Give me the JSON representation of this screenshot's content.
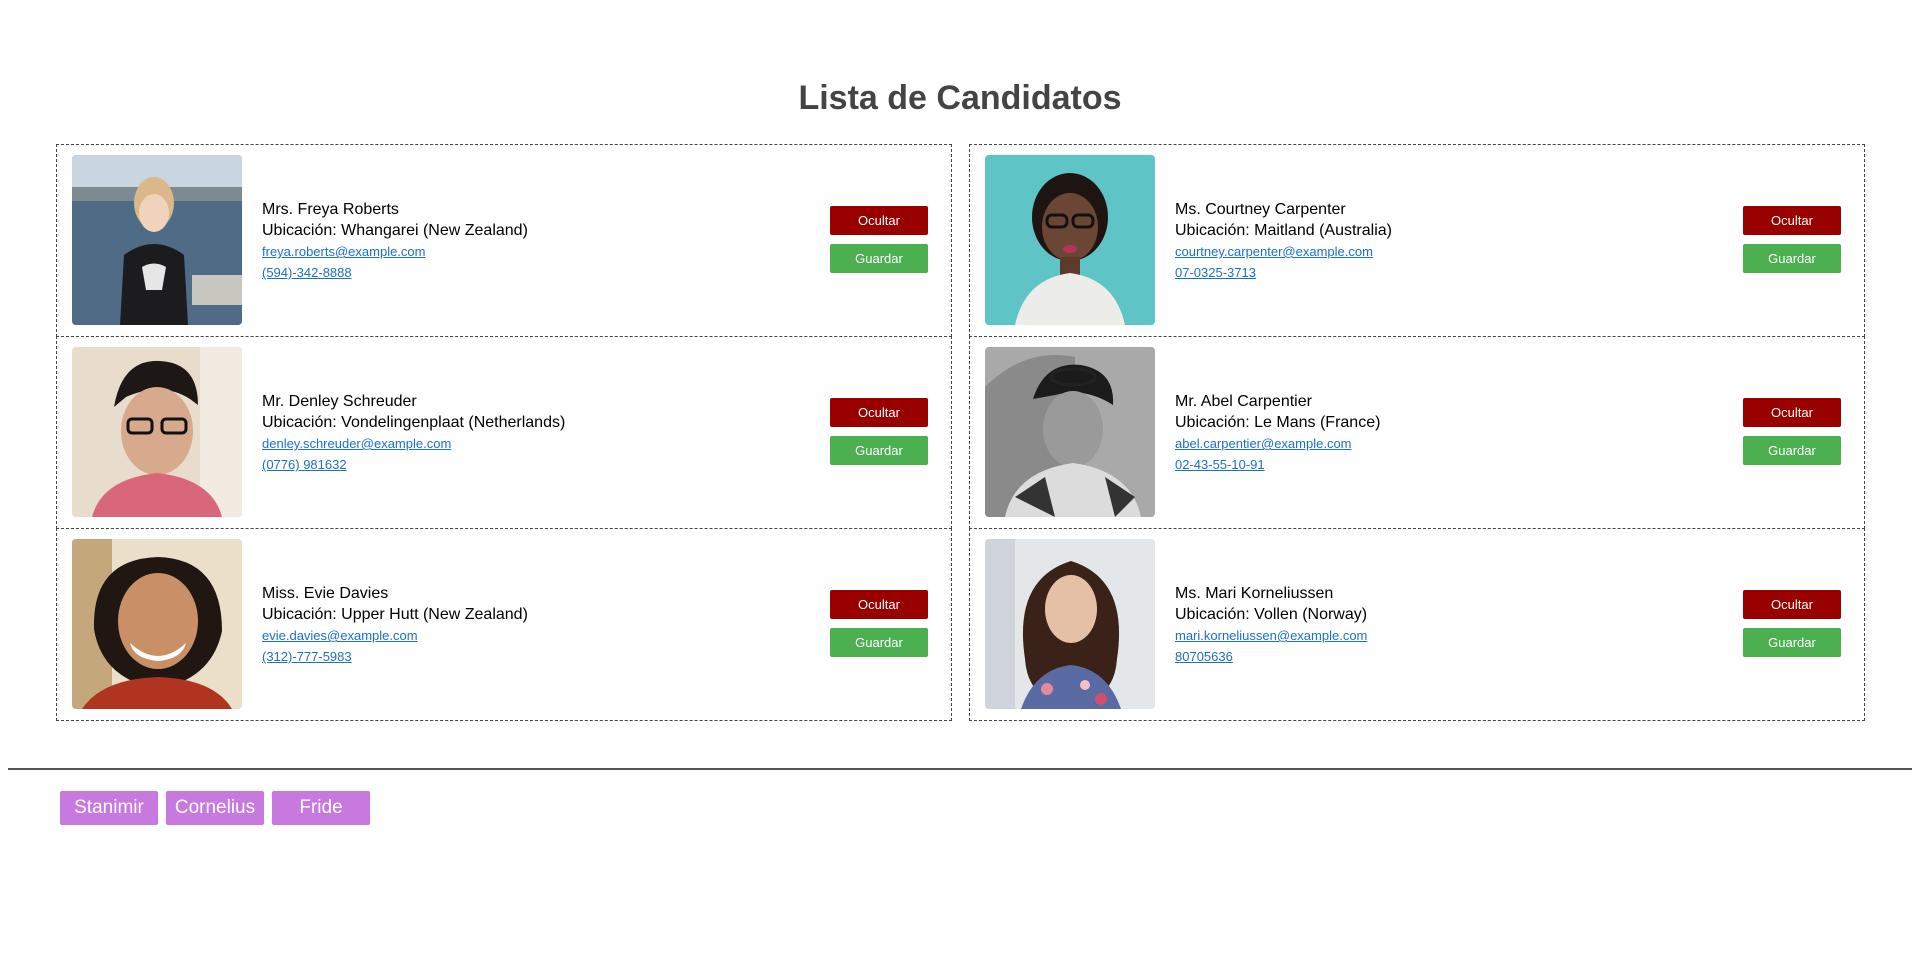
{
  "header": {
    "title": "Lista de Candidatos"
  },
  "candidates": [
    {
      "name": "Mrs. Freya Roberts",
      "location": "Ubicación: Whangarei (New Zealand)",
      "email": "freya.roberts@example.com",
      "phone": "(594)-342-8888",
      "hide_label": "Ocultar",
      "save_label": "Guardar"
    },
    {
      "name": "Ms. Courtney Carpenter",
      "location": "Ubicación: Maitland (Australia)",
      "email": "courtney.carpenter@example.com",
      "phone": "07-0325-3713",
      "hide_label": "Ocultar",
      "save_label": "Guardar"
    },
    {
      "name": "Mr. Denley Schreuder",
      "location": "Ubicación: Vondelingenplaat (Netherlands)",
      "email": "denley.schreuder@example.com",
      "phone": "(0776) 981632",
      "hide_label": "Ocultar",
      "save_label": "Guardar"
    },
    {
      "name": "Mr. Abel Carpentier",
      "location": "Ubicación: Le Mans (France)",
      "email": "abel.carpentier@example.com",
      "phone": "02-43-55-10-91",
      "hide_label": "Ocultar",
      "save_label": "Guardar"
    },
    {
      "name": "Miss. Evie Davies",
      "location": "Ubicación: Upper Hutt (New Zealand)",
      "email": "evie.davies@example.com",
      "phone": "(312)-777-5983",
      "hide_label": "Ocultar",
      "save_label": "Guardar"
    },
    {
      "name": "Ms. Mari Korneliussen",
      "location": "Ubicación: Vollen (Norway)",
      "email": "mari.korneliussen@example.com",
      "phone": "80705636",
      "hide_label": "Ocultar",
      "save_label": "Guardar"
    }
  ],
  "saved": {
    "names": [
      "Stanimir",
      "Cornelius",
      "Fride"
    ]
  },
  "colors": {
    "hide_button": "#990000",
    "save_button": "#4caf50",
    "saved_tag": "#c879e0",
    "link": "#1a6fd1",
    "title": "#444444"
  }
}
